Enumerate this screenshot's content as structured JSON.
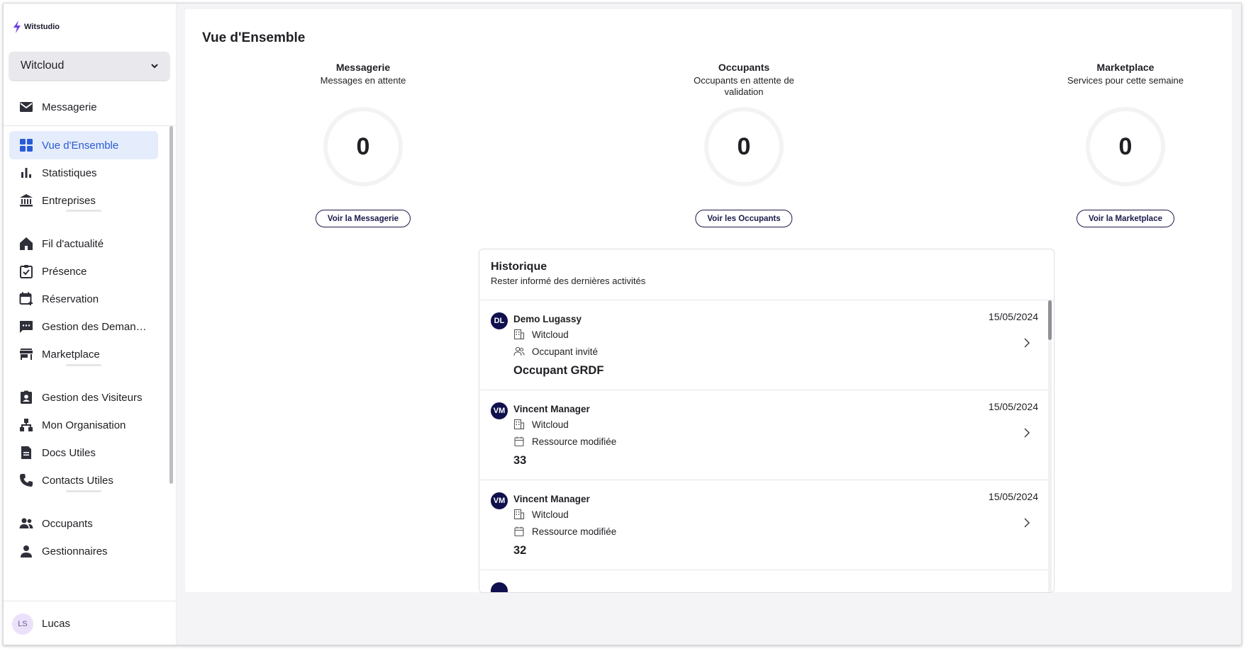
{
  "brand": {
    "name": "Witstudio",
    "color": "#6f3ee0"
  },
  "workspace": {
    "selected": "Witcloud"
  },
  "sidebar": {
    "top_item": {
      "label": "Messagerie",
      "icon": "mail-icon"
    },
    "groups": [
      [
        {
          "label": "Vue d'Ensemble",
          "icon": "dashboard-icon",
          "active": true
        },
        {
          "label": "Statistiques",
          "icon": "bar-chart-icon"
        },
        {
          "label": "Entreprises",
          "icon": "bank-icon"
        }
      ],
      [
        {
          "label": "Fil d'actualité",
          "icon": "home-icon"
        },
        {
          "label": "Présence",
          "icon": "clipboard-check-icon"
        },
        {
          "label": "Réservation",
          "icon": "calendar-plus-icon"
        },
        {
          "label": "Gestion des Deman…",
          "icon": "chat-icon"
        },
        {
          "label": "Marketplace",
          "icon": "store-icon"
        }
      ],
      [
        {
          "label": "Gestion des Visiteurs",
          "icon": "badge-icon"
        },
        {
          "label": "Mon Organisation",
          "icon": "org-chart-icon"
        },
        {
          "label": "Docs Utiles",
          "icon": "document-icon"
        },
        {
          "label": "Contacts Utiles",
          "icon": "phone-icon"
        }
      ],
      [
        {
          "label": "Occupants",
          "icon": "people-icon"
        },
        {
          "label": "Gestionnaires",
          "icon": "person-icon"
        }
      ]
    ]
  },
  "user": {
    "initials": "LS",
    "name": "Lucas"
  },
  "page": {
    "title": "Vue d'Ensemble"
  },
  "cards": [
    {
      "title": "Messagerie",
      "subtitle": "Messages en attente",
      "count": "0",
      "button": "Voir la Messagerie"
    },
    {
      "title": "Occupants",
      "subtitle": "Occupants en attente de validation",
      "count": "0",
      "button": "Voir les Occupants"
    },
    {
      "title": "Marketplace",
      "subtitle": "Services pour cette semaine",
      "count": "0",
      "button": "Voir la Marketplace"
    }
  ],
  "history": {
    "title": "Historique",
    "subtitle": "Rester informé des dernières activités",
    "entries": [
      {
        "initials": "DL",
        "name": "Demo Lugassy",
        "date": "15/05/2024",
        "company": "Witcloud",
        "action": "Occupant invité",
        "action_icon": "people-outline-icon",
        "value": "Occupant GRDF"
      },
      {
        "initials": "VM",
        "name": "Vincent Manager",
        "date": "15/05/2024",
        "company": "Witcloud",
        "action": "Ressource modifiée",
        "action_icon": "calendar-outline-icon",
        "value": "33"
      },
      {
        "initials": "VM",
        "name": "Vincent Manager",
        "date": "15/05/2024",
        "company": "Witcloud",
        "action": "Ressource modifiée",
        "action_icon": "calendar-outline-icon",
        "value": "32"
      }
    ]
  },
  "colors": {
    "accent": "#2a5bd7",
    "active_bg": "#e5ecfb",
    "avatar_dark": "#10104e",
    "button_border": "#1b1b4b"
  }
}
